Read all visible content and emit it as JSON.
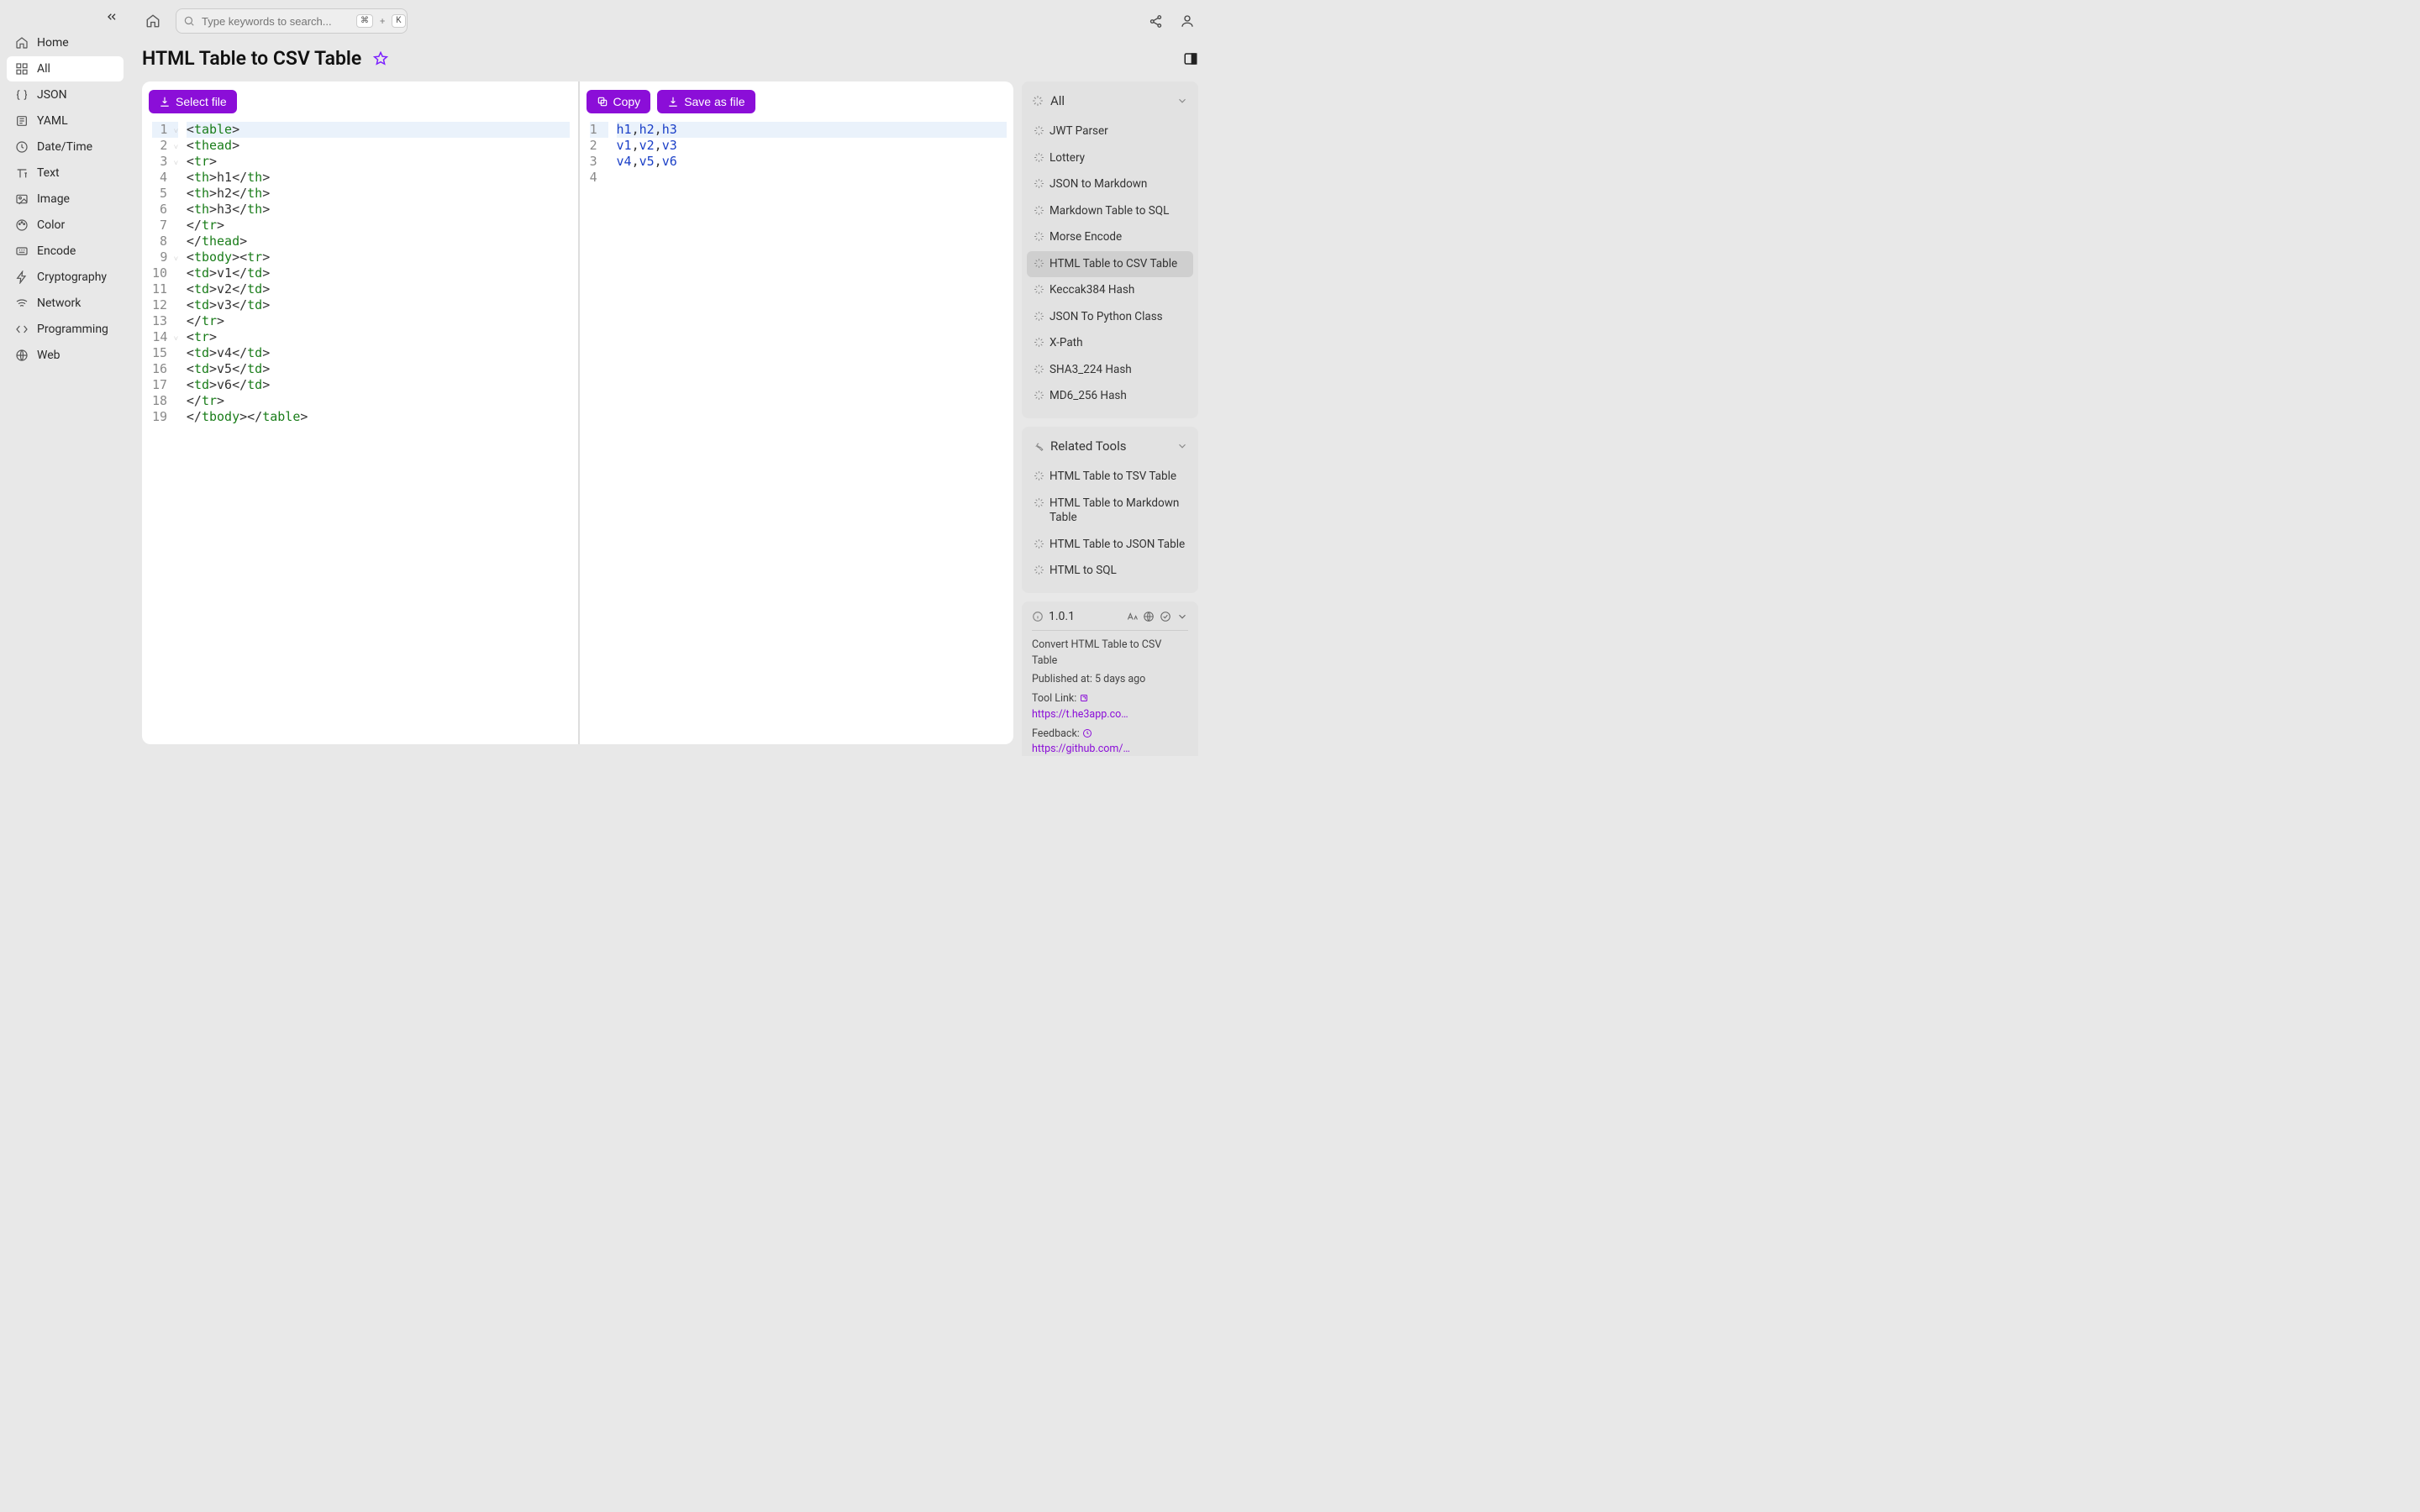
{
  "sidebar": {
    "items": [
      {
        "label": "Home",
        "icon": "home-icon"
      },
      {
        "label": "All",
        "icon": "grid-icon"
      },
      {
        "label": "JSON",
        "icon": "json-icon"
      },
      {
        "label": "YAML",
        "icon": "yaml-icon"
      },
      {
        "label": "Date/Time",
        "icon": "clock-icon"
      },
      {
        "label": "Text",
        "icon": "text-icon"
      },
      {
        "label": "Image",
        "icon": "image-icon"
      },
      {
        "label": "Color",
        "icon": "palette-icon"
      },
      {
        "label": "Encode",
        "icon": "encode-icon"
      },
      {
        "label": "Cryptography",
        "icon": "bolt-icon"
      },
      {
        "label": "Network",
        "icon": "wifi-icon"
      },
      {
        "label": "Programming",
        "icon": "code-icon"
      },
      {
        "label": "Web",
        "icon": "globe-icon"
      }
    ]
  },
  "topbar": {
    "search_placeholder": "Type keywords to search...",
    "shortcut_cmd": "⌘",
    "shortcut_plus": "+",
    "shortcut_k": "K"
  },
  "page": {
    "title": "HTML Table to CSV Table"
  },
  "buttons": {
    "select_file": "Select file",
    "copy": "Copy",
    "save_as_file": "Save as file"
  },
  "editor": {
    "input_lines": [
      {
        "tokens": [
          {
            "t": "<",
            "c": "punct"
          },
          {
            "t": "table",
            "c": "tag"
          },
          {
            "t": ">",
            "c": "punct"
          }
        ],
        "hl": true,
        "fold": true
      },
      {
        "tokens": [
          {
            "t": "<",
            "c": "punct"
          },
          {
            "t": "thead",
            "c": "tag"
          },
          {
            "t": ">",
            "c": "punct"
          }
        ],
        "fold": true
      },
      {
        "tokens": [
          {
            "t": "<",
            "c": "punct"
          },
          {
            "t": "tr",
            "c": "tag"
          },
          {
            "t": ">",
            "c": "punct"
          }
        ],
        "fold": true
      },
      {
        "tokens": [
          {
            "t": "<",
            "c": "punct"
          },
          {
            "t": "th",
            "c": "tag"
          },
          {
            "t": ">",
            "c": "punct"
          },
          {
            "t": "h1",
            "c": "txt"
          },
          {
            "t": "</",
            "c": "punct"
          },
          {
            "t": "th",
            "c": "tag"
          },
          {
            "t": ">",
            "c": "punct"
          }
        ]
      },
      {
        "tokens": [
          {
            "t": "<",
            "c": "punct"
          },
          {
            "t": "th",
            "c": "tag"
          },
          {
            "t": ">",
            "c": "punct"
          },
          {
            "t": "h2",
            "c": "txt"
          },
          {
            "t": "</",
            "c": "punct"
          },
          {
            "t": "th",
            "c": "tag"
          },
          {
            "t": ">",
            "c": "punct"
          }
        ]
      },
      {
        "tokens": [
          {
            "t": "<",
            "c": "punct"
          },
          {
            "t": "th",
            "c": "tag"
          },
          {
            "t": ">",
            "c": "punct"
          },
          {
            "t": "h3",
            "c": "txt"
          },
          {
            "t": "</",
            "c": "punct"
          },
          {
            "t": "th",
            "c": "tag"
          },
          {
            "t": ">",
            "c": "punct"
          }
        ]
      },
      {
        "tokens": [
          {
            "t": "</",
            "c": "punct"
          },
          {
            "t": "tr",
            "c": "tag"
          },
          {
            "t": ">",
            "c": "punct"
          }
        ]
      },
      {
        "tokens": [
          {
            "t": "</",
            "c": "punct"
          },
          {
            "t": "thead",
            "c": "tag"
          },
          {
            "t": ">",
            "c": "punct"
          }
        ]
      },
      {
        "tokens": [
          {
            "t": "<",
            "c": "punct"
          },
          {
            "t": "tbody",
            "c": "tag"
          },
          {
            "t": ">",
            "c": "punct"
          },
          {
            "t": "<",
            "c": "punct"
          },
          {
            "t": "tr",
            "c": "tag"
          },
          {
            "t": ">",
            "c": "punct"
          }
        ],
        "fold": true
      },
      {
        "tokens": [
          {
            "t": "<",
            "c": "punct"
          },
          {
            "t": "td",
            "c": "tag"
          },
          {
            "t": ">",
            "c": "punct"
          },
          {
            "t": "v1",
            "c": "txt"
          },
          {
            "t": "</",
            "c": "punct"
          },
          {
            "t": "td",
            "c": "tag"
          },
          {
            "t": ">",
            "c": "punct"
          }
        ]
      },
      {
        "tokens": [
          {
            "t": "<",
            "c": "punct"
          },
          {
            "t": "td",
            "c": "tag"
          },
          {
            "t": ">",
            "c": "punct"
          },
          {
            "t": "v2",
            "c": "txt"
          },
          {
            "t": "</",
            "c": "punct"
          },
          {
            "t": "td",
            "c": "tag"
          },
          {
            "t": ">",
            "c": "punct"
          }
        ]
      },
      {
        "tokens": [
          {
            "t": "<",
            "c": "punct"
          },
          {
            "t": "td",
            "c": "tag"
          },
          {
            "t": ">",
            "c": "punct"
          },
          {
            "t": "v3",
            "c": "txt"
          },
          {
            "t": "</",
            "c": "punct"
          },
          {
            "t": "td",
            "c": "tag"
          },
          {
            "t": ">",
            "c": "punct"
          }
        ]
      },
      {
        "tokens": [
          {
            "t": "</",
            "c": "punct"
          },
          {
            "t": "tr",
            "c": "tag"
          },
          {
            "t": ">",
            "c": "punct"
          }
        ]
      },
      {
        "tokens": [
          {
            "t": "<",
            "c": "punct"
          },
          {
            "t": "tr",
            "c": "tag"
          },
          {
            "t": ">",
            "c": "punct"
          }
        ],
        "fold": true
      },
      {
        "tokens": [
          {
            "t": "<",
            "c": "punct"
          },
          {
            "t": "td",
            "c": "tag"
          },
          {
            "t": ">",
            "c": "punct"
          },
          {
            "t": "v4",
            "c": "txt"
          },
          {
            "t": "</",
            "c": "punct"
          },
          {
            "t": "td",
            "c": "tag"
          },
          {
            "t": ">",
            "c": "punct"
          }
        ]
      },
      {
        "tokens": [
          {
            "t": "<",
            "c": "punct"
          },
          {
            "t": "td",
            "c": "tag"
          },
          {
            "t": ">",
            "c": "punct"
          },
          {
            "t": "v5",
            "c": "txt"
          },
          {
            "t": "</",
            "c": "punct"
          },
          {
            "t": "td",
            "c": "tag"
          },
          {
            "t": ">",
            "c": "punct"
          }
        ]
      },
      {
        "tokens": [
          {
            "t": "<",
            "c": "punct"
          },
          {
            "t": "td",
            "c": "tag"
          },
          {
            "t": ">",
            "c": "punct"
          },
          {
            "t": "v6",
            "c": "txt"
          },
          {
            "t": "</",
            "c": "punct"
          },
          {
            "t": "td",
            "c": "tag"
          },
          {
            "t": ">",
            "c": "punct"
          }
        ]
      },
      {
        "tokens": [
          {
            "t": "</",
            "c": "punct"
          },
          {
            "t": "tr",
            "c": "tag"
          },
          {
            "t": ">",
            "c": "punct"
          }
        ]
      },
      {
        "tokens": [
          {
            "t": "</",
            "c": "punct"
          },
          {
            "t": "tbody",
            "c": "tag"
          },
          {
            "t": ">",
            "c": "punct"
          },
          {
            "t": "</",
            "c": "punct"
          },
          {
            "t": "table",
            "c": "tag"
          },
          {
            "t": ">",
            "c": "punct"
          }
        ]
      }
    ],
    "output_lines": [
      {
        "tokens": [
          {
            "t": "h1",
            "c": "csv"
          },
          {
            "t": ",",
            "c": "comma"
          },
          {
            "t": "h2",
            "c": "csv"
          },
          {
            "t": ",",
            "c": "comma"
          },
          {
            "t": "h3",
            "c": "csv"
          }
        ],
        "hl": true
      },
      {
        "tokens": [
          {
            "t": "v1",
            "c": "csv"
          },
          {
            "t": ",",
            "c": "comma"
          },
          {
            "t": "v2",
            "c": "csv"
          },
          {
            "t": ",",
            "c": "comma"
          },
          {
            "t": "v3",
            "c": "csv"
          }
        ]
      },
      {
        "tokens": [
          {
            "t": "v4",
            "c": "csv"
          },
          {
            "t": ",",
            "c": "comma"
          },
          {
            "t": "v5",
            "c": "csv"
          },
          {
            "t": ",",
            "c": "comma"
          },
          {
            "t": "v6",
            "c": "csv"
          }
        ]
      },
      {
        "tokens": []
      }
    ]
  },
  "rail": {
    "all_header": "All",
    "all_items": [
      "JWT Parser",
      "Lottery",
      "JSON to Markdown",
      "Markdown Table to SQL",
      "Morse Encode",
      "HTML Table to CSV Table",
      "Keccak384 Hash",
      "JSON To Python Class",
      "X-Path",
      "SHA3_224 Hash",
      "MD6_256 Hash"
    ],
    "related_header": "Related Tools",
    "related_items": [
      "HTML Table to TSV Table",
      "HTML Table to Markdown Table",
      "HTML Table to JSON Table",
      "HTML to SQL"
    ]
  },
  "info": {
    "version": "1.0.1",
    "desc": "Convert HTML Table to CSV Table",
    "published_label": "Published at: ",
    "published": "5 days ago",
    "tool_link_label": "Tool Link: ",
    "tool_link": "https://t.he3app.co…",
    "feedback_label": "Feedback: ",
    "feedback": "https://github.com/…"
  }
}
